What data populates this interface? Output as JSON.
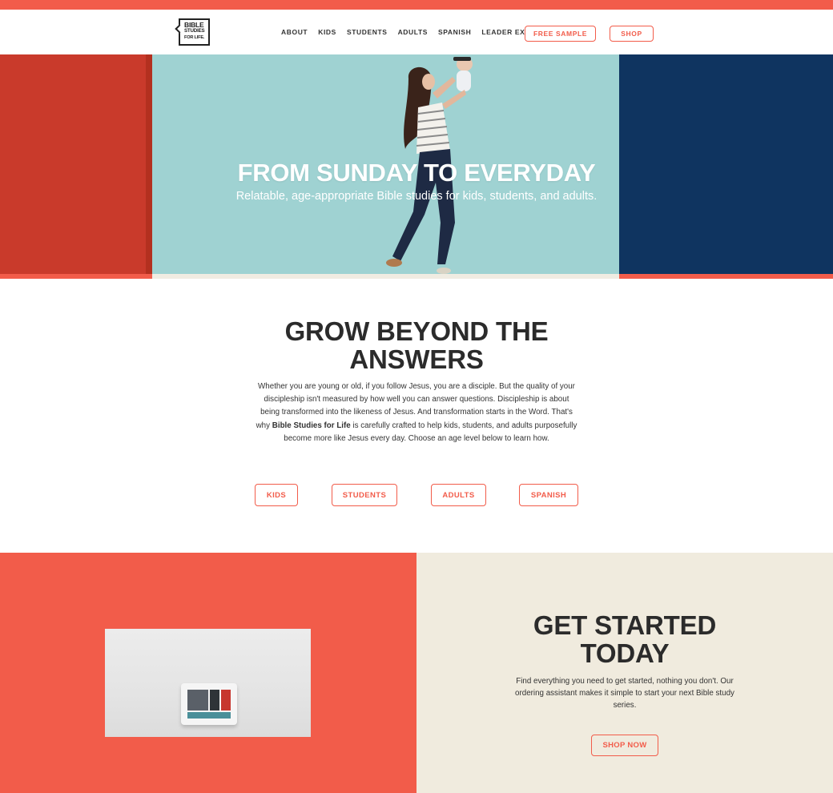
{
  "brand": {
    "logo_line1": "BIBLE",
    "logo_line2": "STUDIES",
    "logo_line3": "FOR LIFE.",
    "accent_color": "#f25c4a"
  },
  "nav": {
    "links": [
      "ABOUT",
      "KIDS",
      "STUDENTS",
      "ADULTS",
      "SPANISH",
      "LEADER EXTRAS"
    ],
    "free_sample": "FREE SAMPLE",
    "shop": "SHOP"
  },
  "hero": {
    "title": "FROM SUNDAY TO EVERYDAY",
    "subtitle": "Relatable, age-appropriate Bible studies for kids, students, and adults."
  },
  "grow": {
    "title_line1": "GROW BEYOND THE",
    "title_line2": "ANSWERS",
    "body_line1": "Whether you are young or old, if you follow Jesus, you are a disciple. But the quality of your",
    "body_line2": "discipleship isn't measured by how well you can answer questions. Discipleship is about",
    "body_line3": "being transformed into the likeness of Jesus. And transformation starts in the Word. That's",
    "body_line4_pre": "why ",
    "body_line4_bold": "Bible Studies for Life",
    "body_line4_post": " is carefully crafted to help kids, students, and adults purposefully",
    "body_line5": "become more like Jesus every day. Choose an age level below to learn how.",
    "buttons": [
      "KIDS",
      "STUDENTS",
      "ADULTS",
      "SPANISH"
    ]
  },
  "get_started": {
    "title_line1": "GET STARTED",
    "title_line2": "TODAY",
    "body_line1": "Find everything you need to get started, nothing you don't. Our",
    "body_line2": "ordering assistant makes it simple to start your next Bible study",
    "body_line3": "series.",
    "button": "SHOP NOW"
  }
}
